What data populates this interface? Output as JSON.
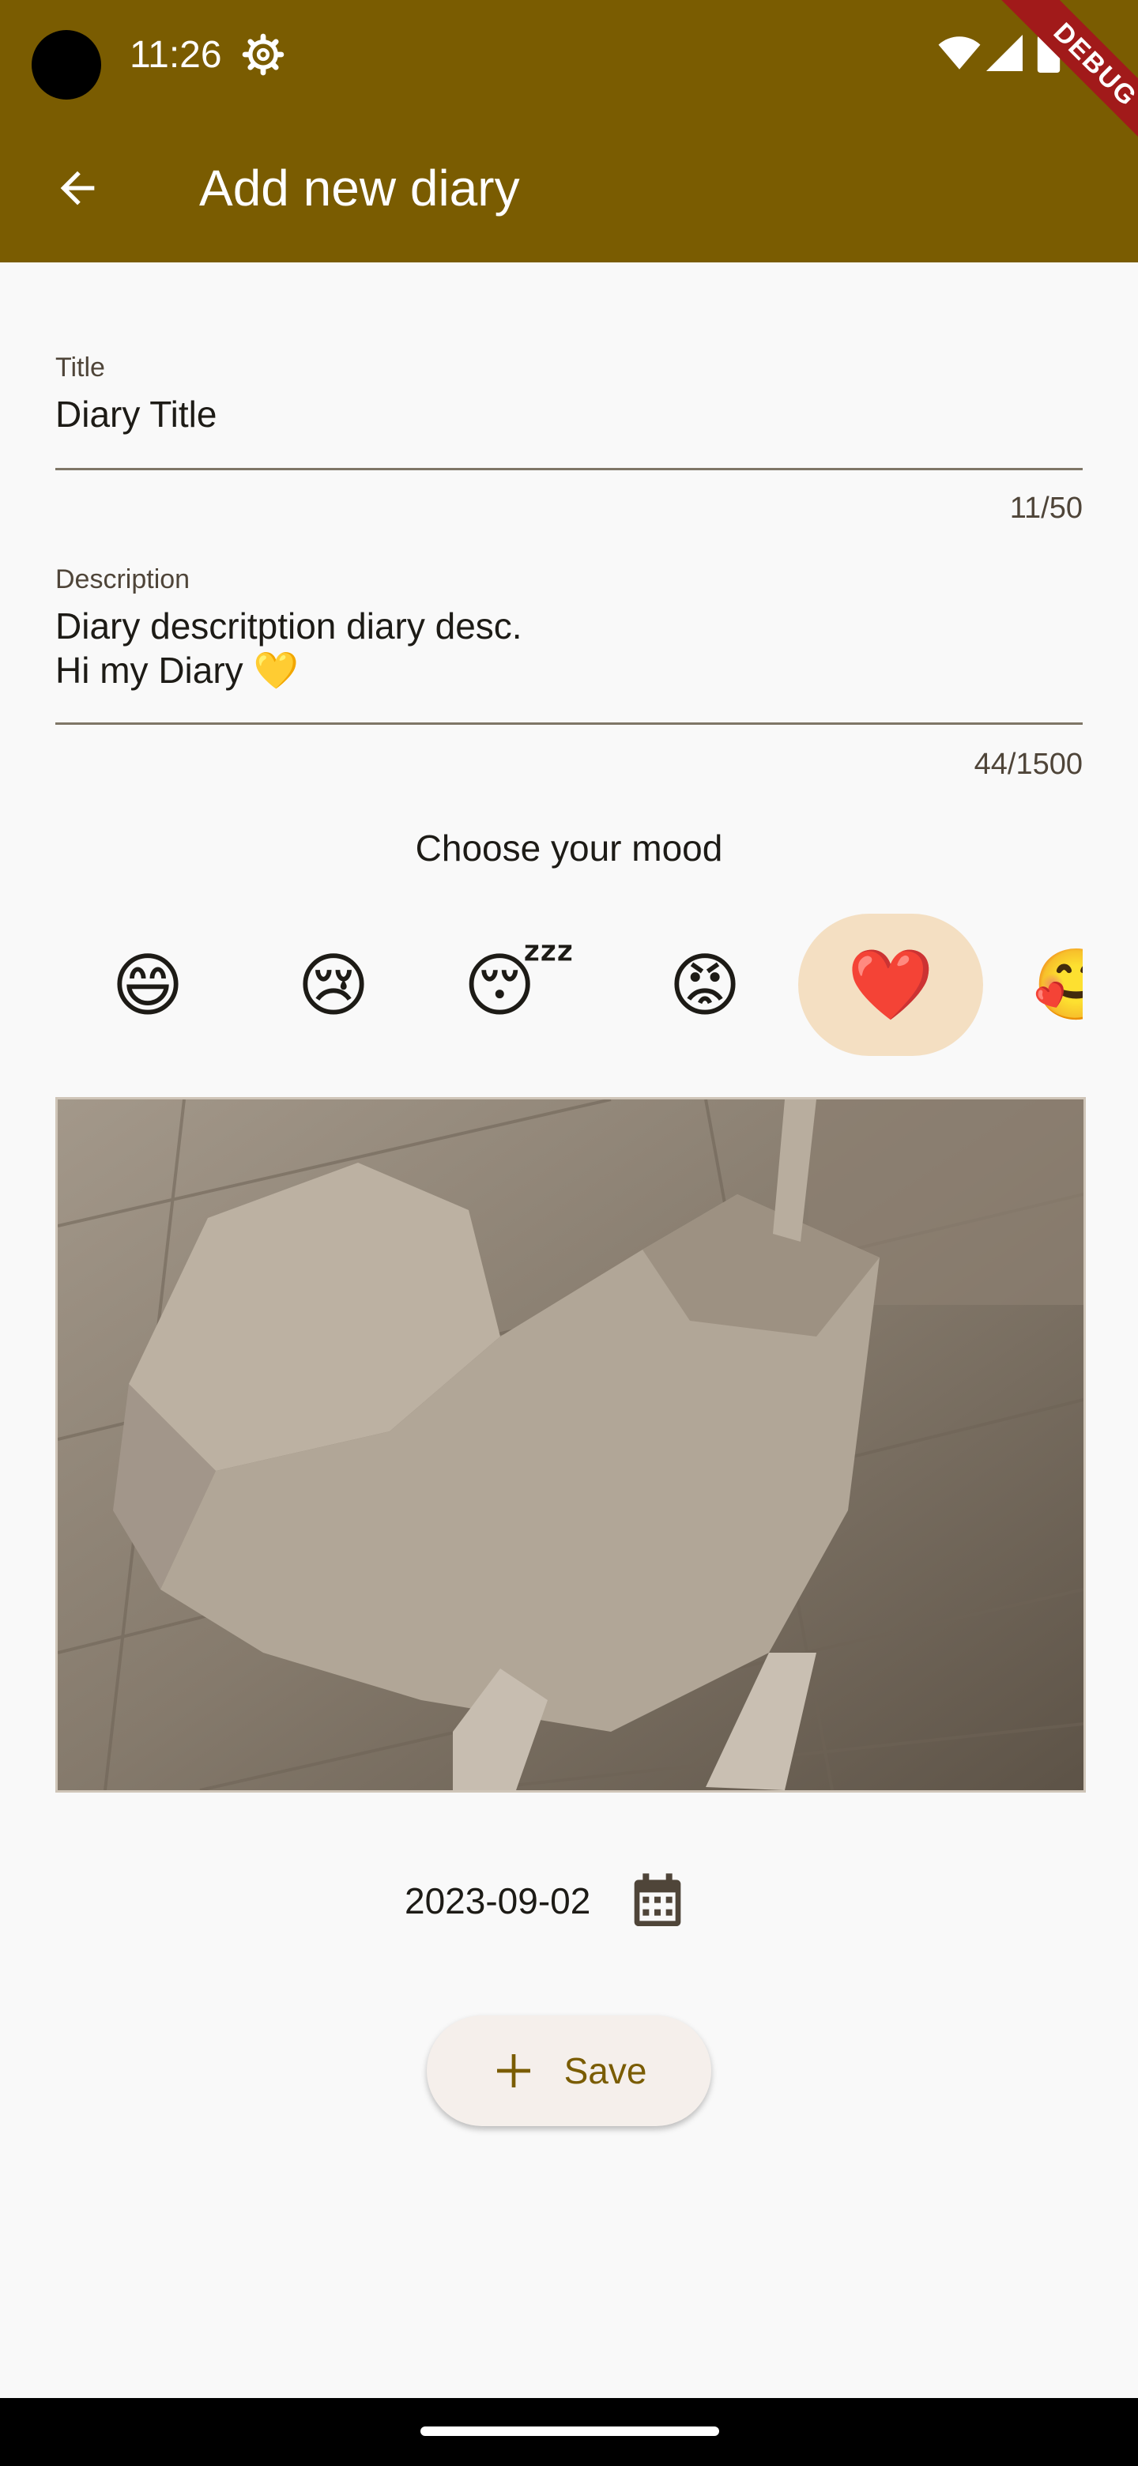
{
  "status_bar": {
    "time": "11:26",
    "debug_label": "DEBUG"
  },
  "app_bar": {
    "title": "Add new diary"
  },
  "form": {
    "title_label": "Title",
    "title_value": "Diary Title",
    "title_counter": "11/50",
    "description_label": "Description",
    "description_line1": "Diary descritption diary desc.",
    "description_line2": "Hi my Diary 💛",
    "description_counter": "44/1500"
  },
  "mood": {
    "prompt": "Choose your mood",
    "options": [
      "😄",
      "😢",
      "😴",
      "😡",
      "❤️",
      "🥰"
    ],
    "selected_index": 4
  },
  "date": {
    "value": "2023-09-02"
  },
  "save_button": {
    "label": "Save"
  },
  "colors": {
    "primary": "#7a5c01",
    "selected_mood_bg": "#f4dfc2",
    "background": "#f9f9f9"
  },
  "icons": [
    "settings-gear-icon",
    "wifi-icon",
    "signal-icon",
    "battery-icon",
    "back-arrow-icon",
    "calendar-icon",
    "plus-icon"
  ]
}
